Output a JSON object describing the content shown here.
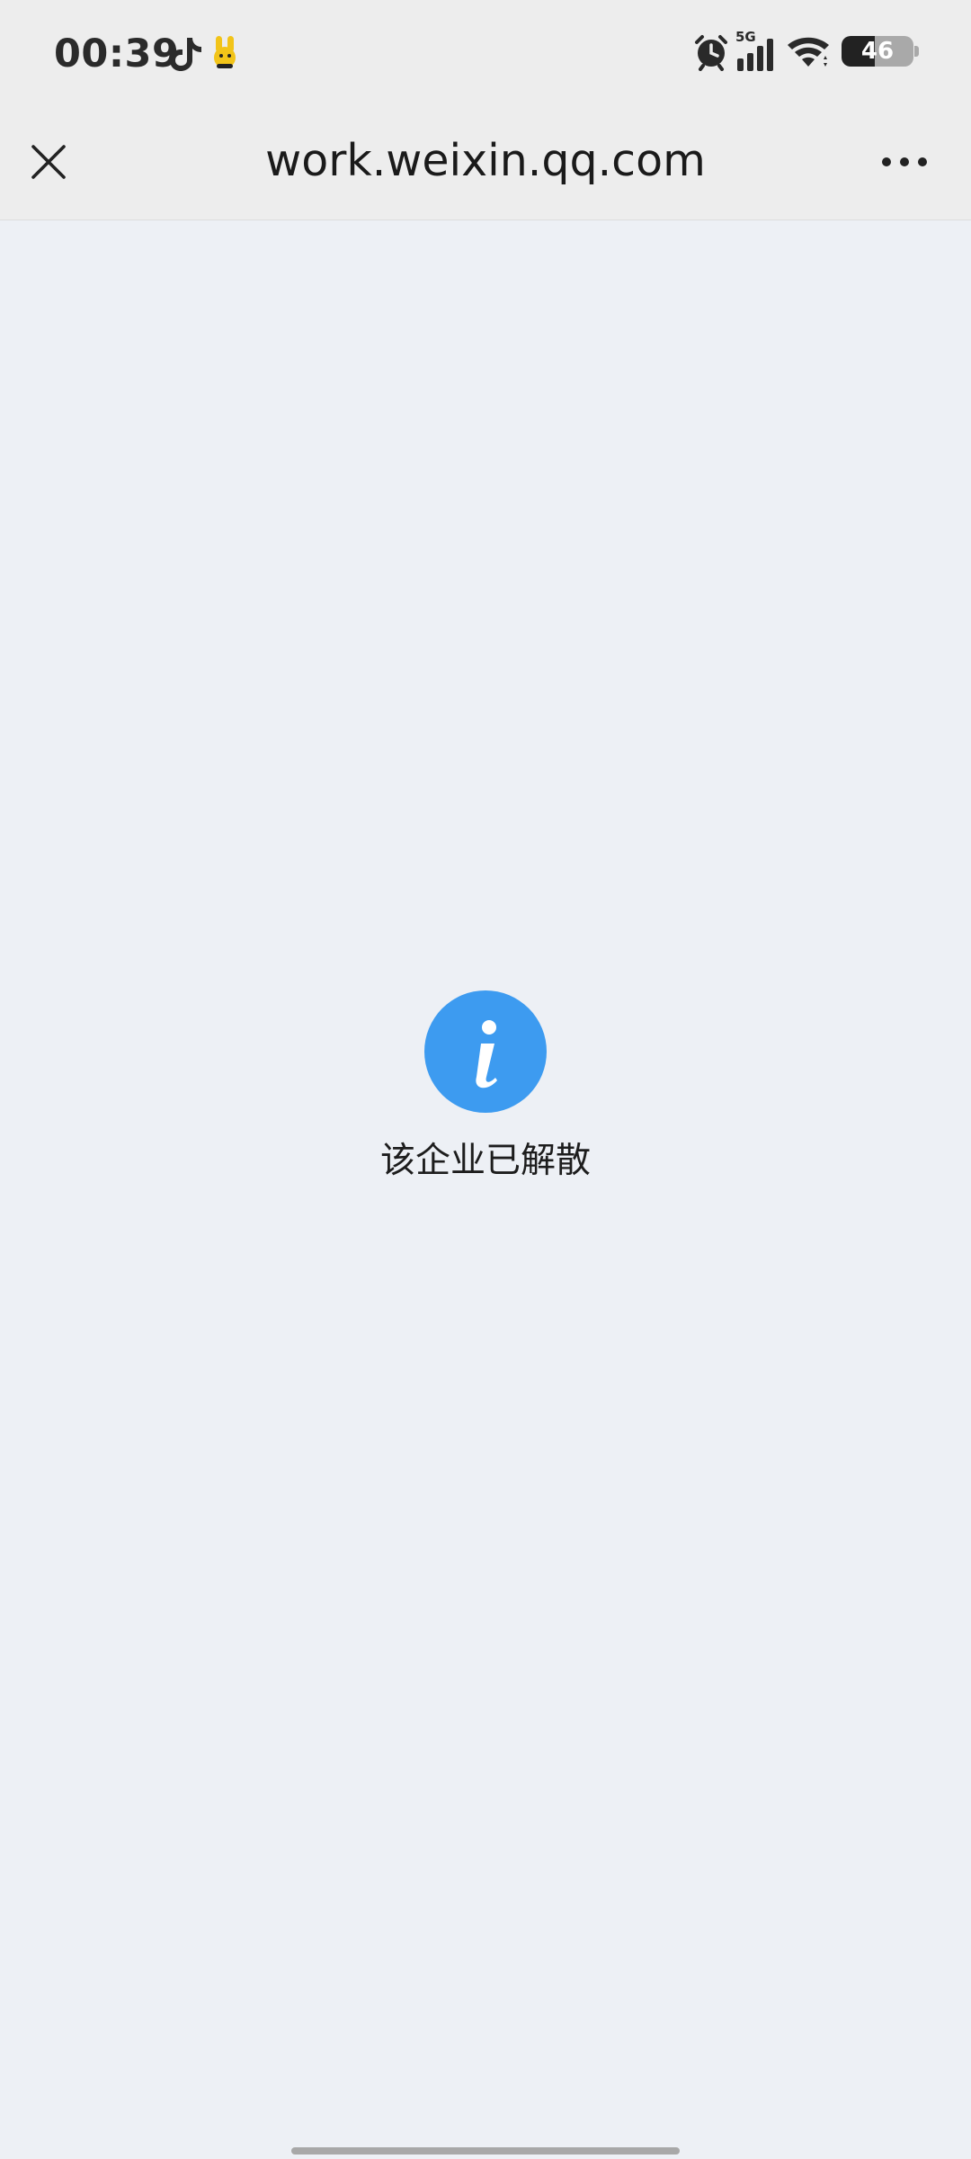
{
  "status_bar": {
    "time": "00:39",
    "network": "5G",
    "battery_percent": "46",
    "battery_level": 0.46,
    "icons": [
      "tiktok-icon",
      "bunny-app-icon",
      "alarm-icon",
      "signal-icon",
      "wifi-icon",
      "battery-icon"
    ]
  },
  "header": {
    "title": "work.weixin.qq.com",
    "close_icon": "close-icon",
    "more_icon": "more-dots-icon"
  },
  "content": {
    "icon": "info-icon",
    "icon_color": "#3d9bf0",
    "message": "该企业已解散"
  }
}
